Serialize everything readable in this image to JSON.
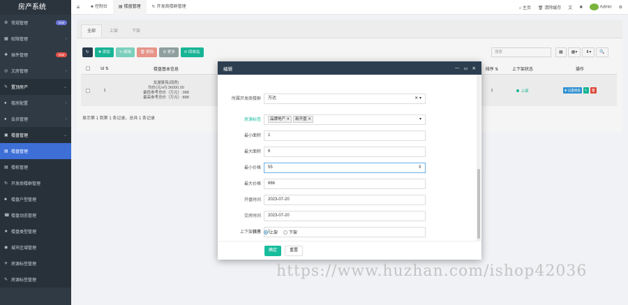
{
  "app": {
    "title": "房产系统"
  },
  "sidebar": {
    "items": [
      {
        "icon": "⚙",
        "label": "常规管理",
        "badge": "new",
        "badge_color": "blue"
      },
      {
        "icon": "▦",
        "label": "权限管理",
        "arrow": "‹"
      },
      {
        "icon": "✚",
        "label": "插件管理",
        "badge": "new",
        "badge_color": "red"
      },
      {
        "icon": "◎",
        "label": "文房管理",
        "arrow": "‹"
      },
      {
        "icon": "✎",
        "label": "置顶房产",
        "arrow": "⌄"
      },
      {
        "icon": "●",
        "label": "楼房配置",
        "arrow": "‹"
      },
      {
        "icon": "●",
        "label": "会员管理",
        "arrow": "‹"
      },
      {
        "icon": "▣",
        "label": "楼盘管理",
        "arrow": "⌄"
      },
      {
        "icon": "▤",
        "label": "楼盘管理"
      },
      {
        "icon": "▤",
        "label": "楼栋管理"
      },
      {
        "icon": "↻",
        "label": "开发商楼群管理"
      },
      {
        "icon": "♣",
        "label": "楼盘户型管理"
      },
      {
        "icon": "☎",
        "label": "楼盘动态管理"
      },
      {
        "icon": "★",
        "label": "楼盘类型管理"
      },
      {
        "icon": "◉",
        "label": "城市区域管理"
      },
      {
        "icon": "✈",
        "label": "房源标签管理"
      },
      {
        "icon": "✎",
        "label": "房源标签管理"
      }
    ]
  },
  "topbar": {
    "hamburger": "≡",
    "tabs": [
      {
        "icon": "♣",
        "label": "控制台"
      },
      {
        "icon": "▤",
        "label": "楼盘管理"
      },
      {
        "icon": "↻",
        "label": "开发商楼群管理"
      }
    ],
    "right": {
      "home": "⌂ 主页",
      "clear": "🗑 清除缓存",
      "lang": "文",
      "fullscreen": "✖",
      "user": "Admin",
      "settings": "⚙"
    }
  },
  "panel": {
    "subtabs": [
      "全部",
      "上架",
      "下架"
    ],
    "toolbar": [
      {
        "label": "↻",
        "style": "dark"
      },
      {
        "label": "✚ 添加",
        "style": "green"
      },
      {
        "label": "✎ 编辑",
        "style": "lgreen"
      },
      {
        "label": "🗑 删除",
        "style": "lred"
      },
      {
        "label": "⚙ 更多",
        "style": "gray"
      },
      {
        "label": "⟳ 回收站",
        "style": "teal"
      }
    ],
    "search_placeholder": "搜索",
    "rbtns": [
      "▦",
      "▦▾",
      "⬇▾",
      "🔍"
    ],
    "table": {
      "headers": [
        "",
        "Id ⇅",
        "楼盘基本信息",
        "",
        "排序 ⇅",
        "上下架状态",
        "操作"
      ],
      "row": {
        "id": "1",
        "info": [
          "龙湖景苑(现房)",
          "均价(元/㎡):36000.00",
          "最低参考总价（万元）:388",
          "最高参考总价（万元）:888"
        ],
        "sort": "1",
        "status": "上架",
        "ops": [
          "✚ 设置楼盘",
          "✎",
          "🗑"
        ]
      }
    },
    "summary": "显示第 1 到第 1 条记录，总共 1 条记录"
  },
  "modal": {
    "title": "编辑",
    "controls": [
      "—",
      "▭",
      "✕"
    ],
    "fields": [
      {
        "label": "所属开发商楼群",
        "value": "万达",
        "suffix": "✕ ▾"
      },
      {
        "label": "房源标签",
        "tags": [
          "品牌地产",
          "新开盘"
        ],
        "suffix": "▾"
      },
      {
        "label": "最小面积",
        "value": "1"
      },
      {
        "label": "最大面积",
        "value": "6"
      },
      {
        "label": "最小价格",
        "value": "55",
        "suffix": "⇕"
      },
      {
        "label": "最大价格",
        "value": "666"
      },
      {
        "label": "开盘时间",
        "value": "2023-07-20"
      },
      {
        "label": "交房时间",
        "value": "2023-07-20"
      },
      {
        "label": "排序",
        "value": "1"
      }
    ],
    "status_label": "上下架状态",
    "status_options": [
      "上架",
      "下架"
    ],
    "ok": "确定",
    "reset": "重置"
  },
  "watermark": "https://www.huzhan.com/ishop42036"
}
